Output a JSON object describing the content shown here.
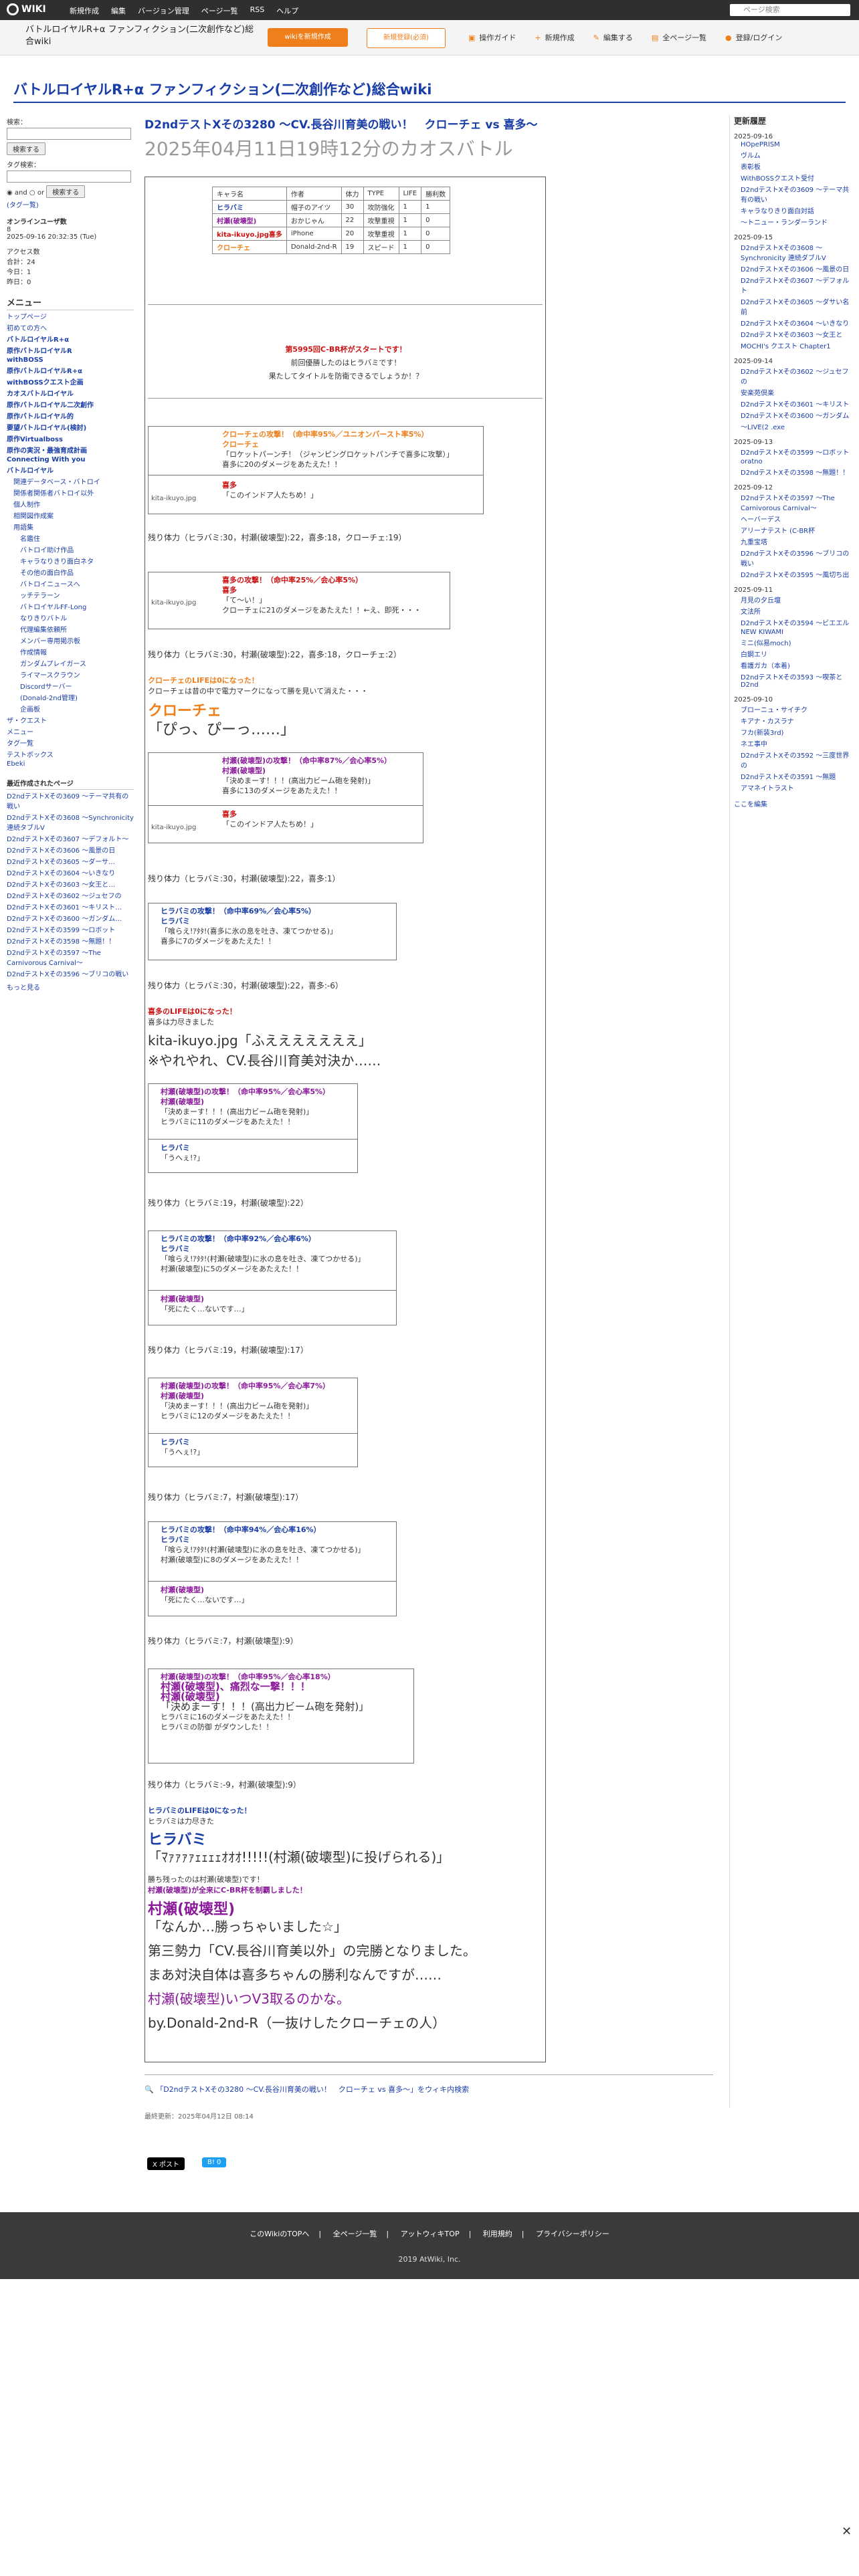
{
  "topbar": {
    "logo": "WIKI",
    "menus": [
      "新規作成",
      "編集",
      "バージョン管理",
      "ページ一覧",
      "RSS",
      "ヘルプ"
    ],
    "search_placeholder": "ページ検索"
  },
  "header": {
    "site_name": "バトルロイヤルR+α ファンフィクション(二次創作など)総合wiki",
    "btn_create": "wikiを新規作成",
    "btn_signup": "新規登録(必須)",
    "tools": [
      "操作ガイド",
      "新規作成",
      "編集する",
      "全ページ一覧",
      "登録/ログイン"
    ]
  },
  "page_title": "バトルロイヤルR+α ファンフィクション(二次創作など)総合wiki",
  "left": {
    "search_label": "検索：",
    "search_btn": "検索する",
    "tag_label": "タグ検索：",
    "and": "and",
    "or": "or",
    "tag_btn": "検索する",
    "tag_cloud": "(タグ一覧)",
    "online_label": "オンラインユーザ数",
    "online_count": "8",
    "now_time": "2025-09-16 20:32:35 (Tue)",
    "access_label": "アクセス数",
    "access_total": "合計：24",
    "access_today": "今日：1",
    "access_yesterday": "昨日：0",
    "menu_head": "メニュー",
    "menu": [
      "トップページ",
      "初めての方へ",
      "バトルロイヤルR+α",
      "原作バトルロイヤルR",
      "withBOSS",
      "原作バトルロイヤルR+α",
      "withBOSSクエスト企画",
      "カオスバトルロイヤル",
      "原作バトルロイヤル二次創作",
      "原作バトルロイヤル的",
      "要望バトルロイヤル(検討)",
      "原作Virtualboss",
      "原作の実況・最強育成計画",
      "Connecting With you",
      "バトルロイヤル",
      "関連データベース・バトロイ",
      "関係者関係者バトロイ以外",
      "個人制作",
      "相関図作成案",
      "用語集",
      "名鑑住",
      "バトロイ助け作品",
      "キャラなりきり面白ネタ",
      "その他の面白作品",
      "バトロイニュースへ",
      "ッチテラーン",
      "バトロイヤルFF-Long",
      "なりきりバトル",
      "代理編集依頼所",
      "メンバー専用掲示板",
      "作成情報",
      "ガンダムプレイガース",
      "ライマースクラウン",
      "Discordサーバー",
      "(Donald-2nd管理)",
      "企画板",
      "ザ・クエスト",
      "メニュー",
      "タグ一覧",
      "テストボックス",
      "Ebeki"
    ],
    "recent_head": "最近作成されたページ",
    "recent": [
      "D2ndテストXその3609 〜テーマ共有の戦い",
      "D2ndテストXその3608 〜Synchronicity 連続タブルV",
      "D2ndテストXその3607 〜デフォルト〜",
      "D2ndテストXその3606 〜風景の日",
      "D2ndテストXその3605 〜ダーサ…",
      "D2ndテストXその3604 〜いきなり",
      "D2ndテストXその3603 〜女王と…",
      "D2ndテストXその3602 〜ジュセフの",
      "D2ndテストXその3601 〜キリスト…",
      "D2ndテストXその3600 〜ガンダム…",
      "D2ndテストXその3599 〜ロボット",
      "D2ndテストXその3598 〜無題！！",
      "D2ndテストXその3597 〜The Carnivorous Carnival〜",
      "D2ndテストXその3596 〜ブリコの戦い"
    ],
    "more": "もっと見る"
  },
  "article": {
    "heading": "D2ndテストXその3280 〜CV.長谷川育美の戦い！　クローチェ vs 喜多〜",
    "subtitle": "2025年04月11日19時12分のカオスバトル",
    "table_head": [
      "キャラ名",
      "作者",
      "体力",
      "TYPE",
      "LIFE",
      "勝利数"
    ],
    "table_rows": [
      [
        "ヒラバミ",
        "帽子のアイツ",
        "30",
        "攻防強化",
        "1",
        "1"
      ],
      [
        "村瀬(破壊型)",
        "おかじゃん",
        "22",
        "攻撃重視",
        "1",
        "0"
      ],
      [
        "kita-ikuyo.jpg喜多",
        "iPhone",
        "20",
        "攻撃重視",
        "1",
        "0"
      ],
      [
        "クローチェ",
        "Donald-2nd-R",
        "19",
        "スピード",
        "1",
        "0"
      ]
    ],
    "intro1": "第5995回C-BR杯がスタートです！",
    "intro2": "前回優勝したのはヒラバミです！",
    "intro3": "果たしてタイトルを防衛できるでしょうか！？",
    "b1": "クローチェの攻撃！（命中率95%／ユニオンバースト率5%）",
    "b1b": "クローチェ",
    "b1c": "「ロケットパーンチ！（ジャンピングロケットパンチで喜多に攻撃）」",
    "b1d": "喜多に20のダメージをあたえた！！",
    "b1e": "喜多",
    "b1f": "「このインドア人たちめ！」",
    "img": "kita-ikuyo.jpg",
    "s1": "残り体力（ヒラバミ:30，村瀬(破壊型):22，喜多:18，クローチェ:19）",
    "b2": "喜多の攻撃！（命中率25%／会心率5%）",
    "b2b": "喜多",
    "b2c": "「て〜い！」",
    "b2d": "クローチェに21のダメージをあたえた！！←え、即死・・・",
    "s2": "残り体力（ヒラバミ:30，村瀬(破壊型):22，喜多:18，クローチェ:2）",
    "k1": "クローチェのLIFEは0になった！",
    "k2": "クローチェは昔の中で電力マークになって勝を見いて消えた・・・",
    "k3": "クローチェ",
    "k4": "「ぴっ、ぴーっ……」",
    "b3": "村瀬(破壊型)の攻撃！（命中率87%／会心率5%）",
    "b3b": "村瀬(破壊型)",
    "b3c": "「決めまーす！！！(高出力ビーム砲を発射)」",
    "b3d": "喜多に13のダメージをあたえた！！",
    "b3e": "喜多",
    "b3f": "「このインドア人たちめ！」",
    "s3": "残り体力（ヒラバミ:30，村瀬(破壊型):22，喜多:1）",
    "b4": "ヒラバミの攻撃！（命中率69%／会心率5%）",
    "b4b": "ヒラバミ",
    "b4c": "「喰らえ!ｱﾀﾀ!(喜多に氷の息を吐き、凍てつかせる)」",
    "b4d": "喜多に7のダメージをあたえた！！",
    "s4": "残り体力（ヒラバミ:30，村瀬(破壊型):22，喜多:-6）",
    "k5": "喜多のLIFEは0になった！",
    "k6": "喜多は力尽きました",
    "k7": "kita-ikuyo.jpg「ふえええええええ」",
    "k8": "※やれやれ、CV.長谷川育美対決か……",
    "b5": "村瀬(破壊型)の攻撃！（命中率95%／会心率5%）",
    "b5b": "村瀬(破壊型)",
    "b5c": "「決めまーす！！！(高出力ビーム砲を発射)」",
    "b5d": "ヒラバミに11のダメージをあたえた！！",
    "b5e": "ヒラバミ",
    "b5f": "「うへぇ!?」",
    "s5": "残り体力（ヒラバミ:19，村瀬(破壊型):22）",
    "b6": "ヒラバミの攻撃！（命中率92%／会心率6%）",
    "b6b": "ヒラバミ",
    "b6c": "「喰らえ!ｱﾀﾀ!(村瀬(破壊型)に氷の息を吐き、凍てつかせる)」",
    "b6d": "村瀬(破壊型)に5のダメージをあたえた！！",
    "b6e": "村瀬(破壊型)",
    "b6f": "「死にたく…ないです…」",
    "s6": "残り体力（ヒラバミ:19，村瀬(破壊型):17）",
    "b7": "村瀬(破壊型)の攻撃！（命中率95%／会心率7%）",
    "b7b": "村瀬(破壊型)",
    "b7c": "「決めまーす！！！(高出力ビーム砲を発射)」",
    "b7d": "ヒラバミに12のダメージをあたえた！！",
    "b7e": "ヒラバミ",
    "b7f": "「うへぇ!?」",
    "s7": "残り体力（ヒラバミ:7，村瀬(破壊型):17）",
    "b8": "ヒラバミの攻撃！（命中率94%／会心率16%）",
    "b8b": "ヒラバミ",
    "b8c": "「喰らえ!ｱﾀﾀ!(村瀬(破壊型)に氷の息を吐き、凍てつかせる)」",
    "b8d": "村瀬(破壊型)に8のダメージをあたえた！！",
    "b8e": "村瀬(破壊型)",
    "b8f": "「死にたく…ないです…」",
    "s8": "残り体力（ヒラバミ:7，村瀬(破壊型):9）",
    "b9": "村瀬(破壊型)の攻撃！（命中率95%／会心率18%）",
    "b9b": "村瀬(破壊型)、痛烈な一撃！！！",
    "b9c": "村瀬(破壊型)",
    "b9d": "「決めまーす！！！(高出力ビーム砲を発射)」",
    "b9e": "ヒラバミに16のダメージをあたえた！！",
    "b9f": "ヒラバミの防御 がダウンした！！",
    "s9": "残り体力（ヒラバミ:-9，村瀬(破壊型):9）",
    "e1": "ヒラバミのLIFEは0になった！",
    "e2": "ヒラバミは力尽きた",
    "e3": "ヒラバミ",
    "e4": "「ﾏｧｧｧｧｪｪｪｪｵｵｵ!!!!!(村瀬(破壊型)に投げられる)」",
    "e5": "勝ち残ったのは村瀬(破壊型)です！",
    "e6": "村瀬(破壊型)が全来にC-BR杯を制覇しました！",
    "e7": "村瀬(破壊型)",
    "e8": "「なんか…勝っちゃいました☆」",
    "e9": "第三勢力「CV.長谷川育美以外」の完勝となりました。",
    "e10": "まあ対決自体は喜多ちゃんの勝利なんですが……",
    "e11": "村瀬(破壊型)いつV3取るのかな。",
    "e12": "by.Donald-2nd-R（一抜けしたクローチェの人）",
    "edit_link": "「D2ndテストXその3280 〜CV.長谷川育美の戦い！　クローチェ vs 喜多〜」をウィキ内検索",
    "last_update": "最終更新：2025年04月12日 08:14",
    "post_btn": "X ポスト",
    "share_btn": "B! 0"
  },
  "right": {
    "head": "更新履歴",
    "groups": [
      {
        "date": "2025-09-16",
        "items": [
          "HOpePRISM",
          "ヴルム",
          "表彰板",
          "WithBOSSクエスト受付",
          "D2ndテストXその3609 〜テーマ共有の戦い",
          "キャラなりきり面白対話",
          "〜トニュー・ランダーランド"
        ]
      },
      {
        "date": "2025-09-15",
        "items": [
          "D2ndテストXその3608 〜Synchronicity 連続ダブルV",
          "D2ndテストXその3606 〜風景の日",
          "D2ndテストXその3607 〜デフォルト",
          "D2ndテストXその3605 〜ダサい名前",
          "D2ndテストXその3604 〜いきなり",
          "D2ndテストXその3603 〜女王と",
          "MOCHI's クエスト Chapter1"
        ]
      },
      {
        "date": "2025-09-14",
        "items": [
          "D2ndテストXその3602 〜ジュセフの",
          "安楽苑倶楽",
          "D2ndテストXその3601 〜キリスト",
          "D2ndテストXその3600 〜ガンダム",
          "〜LIVE(2 .exe"
        ]
      },
      {
        "date": "2025-09-13",
        "items": [
          "D2ndテストXその3599 〜ロボット",
          "oratno",
          "D2ndテストXその3598 〜無題！！"
        ]
      },
      {
        "date": "2025-09-12",
        "items": [
          "D2ndテストXその3597 〜The Carnivorous Carnival〜",
          "ヘーバーデス",
          "アリーナテスト (C-BR杯",
          "九重宝塔",
          "D2ndテストXその3596 〜ブリコの戦い",
          "D2ndテストXその3595 〜風切ち出"
        ]
      },
      {
        "date": "2025-09-11",
        "items": [
          "月見の夕丘壇",
          "文法所",
          "D2ndテストXその3594 〜ビエエル",
          "NEW KIWAMI",
          "ミニ(似易moch)",
          "白鋼エリ",
          "看護ガカ（本着)",
          "D2ndテストXその3593 〜喫茶とD2nd"
        ]
      },
      {
        "date": "2025-09-10",
        "items": [
          "ブローニュ・サイチク",
          "キアナ・カスラナ",
          "フカ(新装3rd)",
          "ネエ事中",
          "D2ndテストXその3592 〜三度世界の",
          "D2ndテストXその3591 〜無題",
          "アマネイトラスト"
        ]
      }
    ],
    "more": "ここを編集"
  },
  "footer": {
    "links": [
      "このWikiのTOPへ",
      "全ページ一覧",
      "アットウィキTOP",
      "利用規約",
      "プライバシーポリシー"
    ],
    "copyright": "2019 AtWiki, Inc."
  }
}
